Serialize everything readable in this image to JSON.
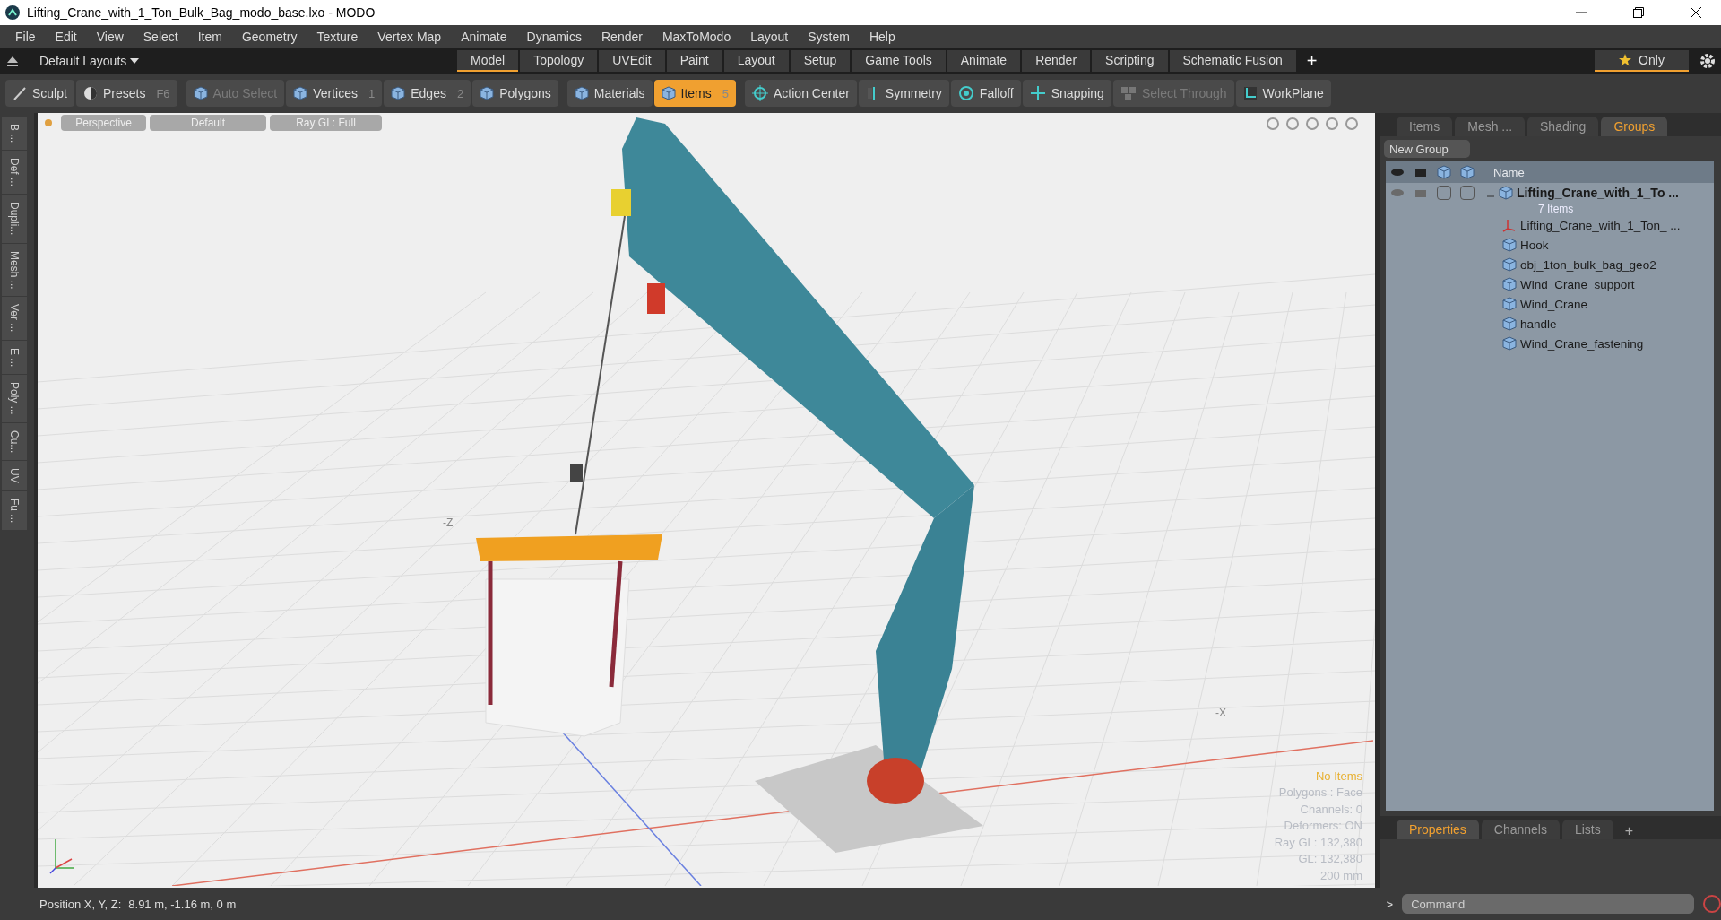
{
  "window": {
    "title": "Lifting_Crane_with_1_Ton_Bulk_Bag_modo_base.lxo - MODO"
  },
  "menu": [
    "File",
    "Edit",
    "View",
    "Select",
    "Item",
    "Geometry",
    "Texture",
    "Vertex Map",
    "Animate",
    "Dynamics",
    "Render",
    "MaxToModo",
    "Layout",
    "System",
    "Help"
  ],
  "layout_selector": "Default Layouts",
  "layout_tabs": [
    {
      "label": "Model",
      "selected": true
    },
    {
      "label": "Topology",
      "selected": false
    },
    {
      "label": "UVEdit",
      "selected": false
    },
    {
      "label": "Paint",
      "selected": false
    },
    {
      "label": "Layout",
      "selected": false
    },
    {
      "label": "Setup",
      "selected": false
    },
    {
      "label": "Game Tools",
      "selected": false
    },
    {
      "label": "Animate",
      "selected": false
    },
    {
      "label": "Render",
      "selected": false
    },
    {
      "label": "Scripting",
      "selected": false
    },
    {
      "label": "Schematic Fusion",
      "selected": false
    }
  ],
  "add_tab": "+",
  "only_toggle": {
    "label": "Only",
    "on": true
  },
  "toolbar": [
    {
      "kind": "sculpt",
      "label": "Sculpt",
      "selected": false,
      "disabled": false
    },
    {
      "kind": "presets",
      "label": "Presets",
      "shortcut": "F6",
      "selected": false,
      "disabled": false
    },
    {
      "kind": "mode",
      "label": "Auto Select",
      "selected": false,
      "disabled": true
    },
    {
      "kind": "mode",
      "label": "Vertices",
      "shortcut": "1",
      "selected": false,
      "disabled": false
    },
    {
      "kind": "mode",
      "label": "Edges",
      "shortcut": "2",
      "selected": false,
      "disabled": false
    },
    {
      "kind": "mode",
      "label": "Polygons",
      "selected": false,
      "disabled": false
    },
    {
      "kind": "mode",
      "label": "Materials",
      "selected": false,
      "disabled": false
    },
    {
      "kind": "mode",
      "label": "Items",
      "shortcut": "5",
      "selected": true,
      "disabled": false
    },
    {
      "kind": "action-center",
      "label": "Action Center",
      "selected": false,
      "disabled": false
    },
    {
      "kind": "symmetry",
      "label": "Symmetry",
      "selected": false,
      "disabled": false
    },
    {
      "kind": "falloff",
      "label": "Falloff",
      "selected": false,
      "disabled": false
    },
    {
      "kind": "snapping",
      "label": "Snapping",
      "selected": false,
      "disabled": false
    },
    {
      "kind": "select-through",
      "label": "Select Through",
      "selected": false,
      "disabled": true
    },
    {
      "kind": "workplane",
      "label": "WorkPlane",
      "selected": false,
      "disabled": false
    }
  ],
  "left_tabs": [
    "B ...",
    "Def ...",
    "Dupli...",
    "Mesh ...",
    "Ver ...",
    "E ...",
    "Poly ...",
    "Cu...",
    "UV",
    "Fu ..."
  ],
  "viewport": {
    "buttons": [
      "Perspective",
      "Default",
      "Ray GL: Full"
    ],
    "axis_labels": [
      "-Z",
      "-X"
    ],
    "info": [
      {
        "text": "No Items",
        "highlight": true
      },
      {
        "text": "Polygons : Face",
        "highlight": false
      },
      {
        "text": "Channels: 0",
        "highlight": false
      },
      {
        "text": "Deformers: ON",
        "highlight": false
      },
      {
        "text": "Ray GL: 132,380",
        "highlight": false
      },
      {
        "text": "GL: 132,380",
        "highlight": false
      },
      {
        "text": "200 mm",
        "highlight": false
      }
    ]
  },
  "right_panel": {
    "tabs": [
      {
        "label": "Items",
        "selected": false
      },
      {
        "label": "Mesh ...",
        "selected": false
      },
      {
        "label": "Shading",
        "selected": false
      },
      {
        "label": "Groups",
        "selected": true
      }
    ],
    "new_group": "New Group",
    "column_name": "Name",
    "tree": {
      "name": "Lifting_Crane_with_1_To ...",
      "count": "7 Items",
      "expanded": true,
      "lock_checked": false,
      "select_checked": false,
      "children": [
        {
          "name": "Lifting_Crane_with_1_Ton_ ...",
          "kind": "locator"
        },
        {
          "name": "Hook",
          "kind": "mesh"
        },
        {
          "name": "obj_1ton_bulk_bag_geo2",
          "kind": "mesh"
        },
        {
          "name": "Wind_Crane_support",
          "kind": "mesh"
        },
        {
          "name": "Wind_Crane",
          "kind": "mesh"
        },
        {
          "name": "handle",
          "kind": "mesh"
        },
        {
          "name": "Wind_Crane_fastening",
          "kind": "mesh"
        }
      ]
    },
    "bottom_tabs": [
      {
        "label": "Properties",
        "selected": true
      },
      {
        "label": "Channels",
        "selected": false
      },
      {
        "label": "Lists",
        "selected": false
      }
    ],
    "add_tab": "+"
  },
  "status_bar": {
    "label": "Position X, Y, Z:",
    "value": "8.91 m, -1.16 m, 0 m",
    "command_placeholder": "Command",
    "prompt": ">"
  }
}
